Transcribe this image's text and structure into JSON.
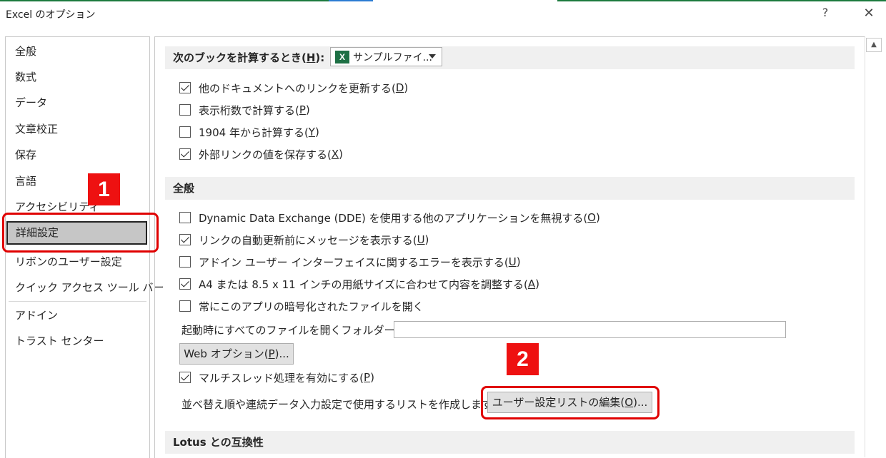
{
  "window": {
    "title": "Excel のオプション",
    "help_label": "?",
    "close_label": "✕"
  },
  "sidebar": {
    "items": [
      {
        "label": "全般"
      },
      {
        "label": "数式"
      },
      {
        "label": "データ"
      },
      {
        "label": "文章校正"
      },
      {
        "label": "保存"
      },
      {
        "label": "言語"
      },
      {
        "label": "アクセシビリティ"
      },
      {
        "label": "詳細設定",
        "selected": true
      },
      {
        "label": "リボンのユーザー設定"
      },
      {
        "label": "クイック アクセス ツール バー"
      },
      {
        "label": "アドイン"
      },
      {
        "label": "トラスト センター"
      }
    ]
  },
  "calc_section": {
    "label": "次のブックを計算するとき(",
    "accel": "H",
    "label_end": "):",
    "workbook_select": {
      "value": "サンプルファイ...",
      "icon": "excel-icon"
    },
    "options": [
      {
        "text": "他のドキュメントへのリンクを更新する(",
        "accel": "D",
        "end": ")",
        "checked": true
      },
      {
        "text": "表示桁数で計算する(",
        "accel": "P",
        "end": ")",
        "checked": false
      },
      {
        "text": "1904 年から計算する(",
        "accel": "Y",
        "end": ")",
        "checked": false
      },
      {
        "text": "外部リンクの値を保存する(",
        "accel": "X",
        "end": ")",
        "checked": true
      }
    ]
  },
  "general_section": {
    "label": "全般",
    "options": [
      {
        "text": "Dynamic Data Exchange (DDE) を使用する他のアプリケーションを無視する(",
        "accel": "O",
        "end": ")",
        "checked": false
      },
      {
        "text": "リンクの自動更新前にメッセージを表示する(",
        "accel": "U",
        "end": ")",
        "checked": true
      },
      {
        "text": "アドイン ユーザー インターフェイスに関するエラーを表示する(",
        "accel": "U",
        "end": ")",
        "checked": false
      },
      {
        "text": "A4 または 8.5 x 11 インチの用紙サイズに合わせて内容を調整する(",
        "accel": "A",
        "end": ")",
        "checked": true
      },
      {
        "text": "常にこのアプリの暗号化されたファイルを開く",
        "accel": "",
        "end": "",
        "checked": false
      }
    ],
    "startup_folder": {
      "text": "起動時にすべてのファイルを開くフォルダー(",
      "accel": "L",
      "end": "):",
      "value": ""
    },
    "web_options_button": {
      "text": "Web オプション(",
      "accel": "P",
      "end": ")..."
    },
    "multithread": {
      "text": "マルチスレッド処理を有効にする(",
      "accel": "P",
      "end": ")",
      "checked": true
    },
    "sort_list": {
      "text": "並べ替え順や連続データ入力設定で使用するリストを作成します:"
    },
    "edit_list_button": {
      "text": "ユーザー設定リストの編集(",
      "accel": "O",
      "end": ")..."
    }
  },
  "lotus_section": {
    "label": "Lotus との互換性"
  },
  "annotations": {
    "badge1": "1",
    "badge2": "2",
    "color": "#ee1111"
  }
}
